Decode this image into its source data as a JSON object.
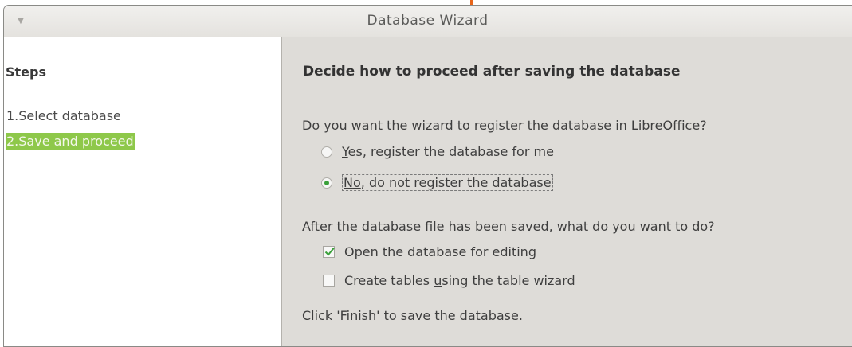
{
  "window": {
    "title": "Database Wizard",
    "menu_icon": "window-menu-arrow-icon"
  },
  "steps": {
    "title": "Steps",
    "items": [
      {
        "label": "1.Select database",
        "active": false
      },
      {
        "label": "2.Save and proceed",
        "active": true
      }
    ]
  },
  "content": {
    "heading": "Decide how to proceed after saving the database",
    "register_question": "Do you want the wizard to register the database in LibreOffice?",
    "register_options": [
      {
        "mnemonic": "Y",
        "rest": "es, register the database for me",
        "selected": false
      },
      {
        "mnemonic": "N",
        "prefix": "",
        "mid": "o",
        "mnemonic2": "",
        "rest": ", do not register the database",
        "selected": true
      }
    ],
    "after_question": "After the database file has been saved, what do you want to do?",
    "after_options": [
      {
        "label": "Open the database for editing",
        "checked": true
      },
      {
        "prefix": "Create tables ",
        "mnemonic": "u",
        "rest": "sing the table wizard",
        "checked": false
      }
    ],
    "finish_note": "Click 'Finish' to save the database."
  },
  "colors": {
    "active_step_bg": "#8ec84a",
    "radio_selected": "#3aa03a",
    "checkmark": "#3aa03a",
    "accent_mark": "#e8651a"
  }
}
